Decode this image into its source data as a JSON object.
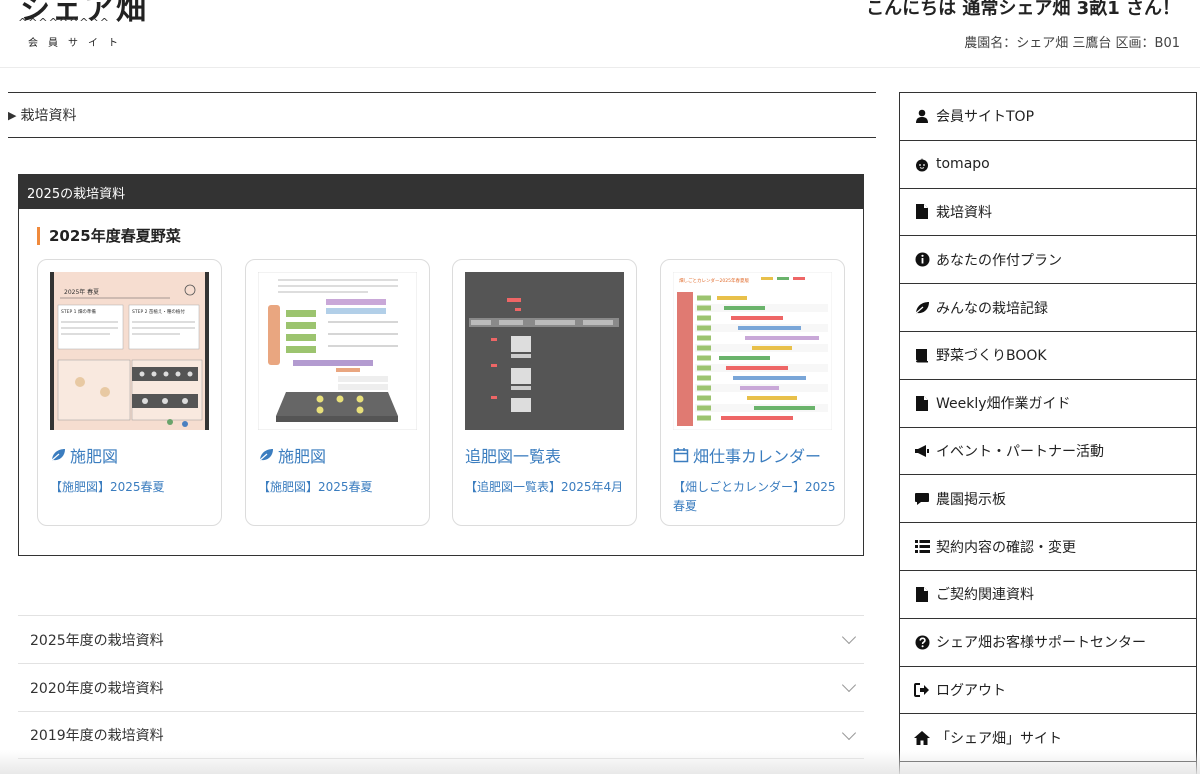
{
  "header": {
    "logo_title": "シェア畑",
    "logo_wave": "^^^^^^^^^",
    "logo_sub": "会員サイト",
    "greeting": "こんにちは 通常シェア畑 3畝1 さん！",
    "farm_info": "農園名：シェア畑 三鷹台 区画：B01"
  },
  "breadcrumb": {
    "label": "栽培資料"
  },
  "panel": {
    "header": "2025の栽培資料",
    "section_title": "2025年度春夏野菜",
    "cards": [
      {
        "icon": "leaf-icon",
        "title": "施肥図",
        "subtitle": "【施肥図】2025春夏"
      },
      {
        "icon": "leaf-icon",
        "title": "施肥図",
        "subtitle": "【施肥図】2025春夏"
      },
      {
        "icon": "",
        "title": "追肥図一覧表",
        "subtitle": "【追肥図一覧表】2025年4月"
      },
      {
        "icon": "calendar-icon",
        "title": "畑仕事カレンダー",
        "subtitle": "【畑しごとカレンダー】2025春夏"
      }
    ],
    "thumb_text": {
      "t1_title": "2025年 春夏",
      "t1_step1": "STEP 1 畑の準備",
      "t1_step2": "STEP 2 苗植え・種の植付",
      "t4_title": "畑しごとカレンダー2025年春夏版"
    }
  },
  "accordion": [
    {
      "label": "2025年度の栽培資料"
    },
    {
      "label": "2020年度の栽培資料"
    },
    {
      "label": "2019年度の栽培資料"
    }
  ],
  "sidebar": [
    {
      "icon": "user-icon",
      "label": "会員サイトTOP"
    },
    {
      "icon": "tomato-icon",
      "label": "tomapo"
    },
    {
      "icon": "file-icon",
      "label": "栽培資料"
    },
    {
      "icon": "info-icon",
      "label": "あなたの作付プラン"
    },
    {
      "icon": "leaf-icon",
      "label": "みんなの栽培記録"
    },
    {
      "icon": "book-icon",
      "label": "野菜づくりBOOK"
    },
    {
      "icon": "file-icon",
      "label": "Weekly畑作業ガイド"
    },
    {
      "icon": "megaphone-icon",
      "label": "イベント・パートナー活動"
    },
    {
      "icon": "comment-icon",
      "label": "農園掲示板"
    },
    {
      "icon": "list-icon",
      "label": "契約内容の確認・変更"
    },
    {
      "icon": "file-icon",
      "label": "ご契約関連資料"
    },
    {
      "icon": "question-icon",
      "label": "シェア畑お客様サポートセンター"
    },
    {
      "icon": "logout-icon",
      "label": "ログアウト"
    },
    {
      "icon": "home-icon",
      "label": "「シェア畑」サイト"
    }
  ],
  "colors": {
    "link": "#3b7dbf",
    "accent": "#f08a3c",
    "panel_header_bg": "#333333"
  }
}
